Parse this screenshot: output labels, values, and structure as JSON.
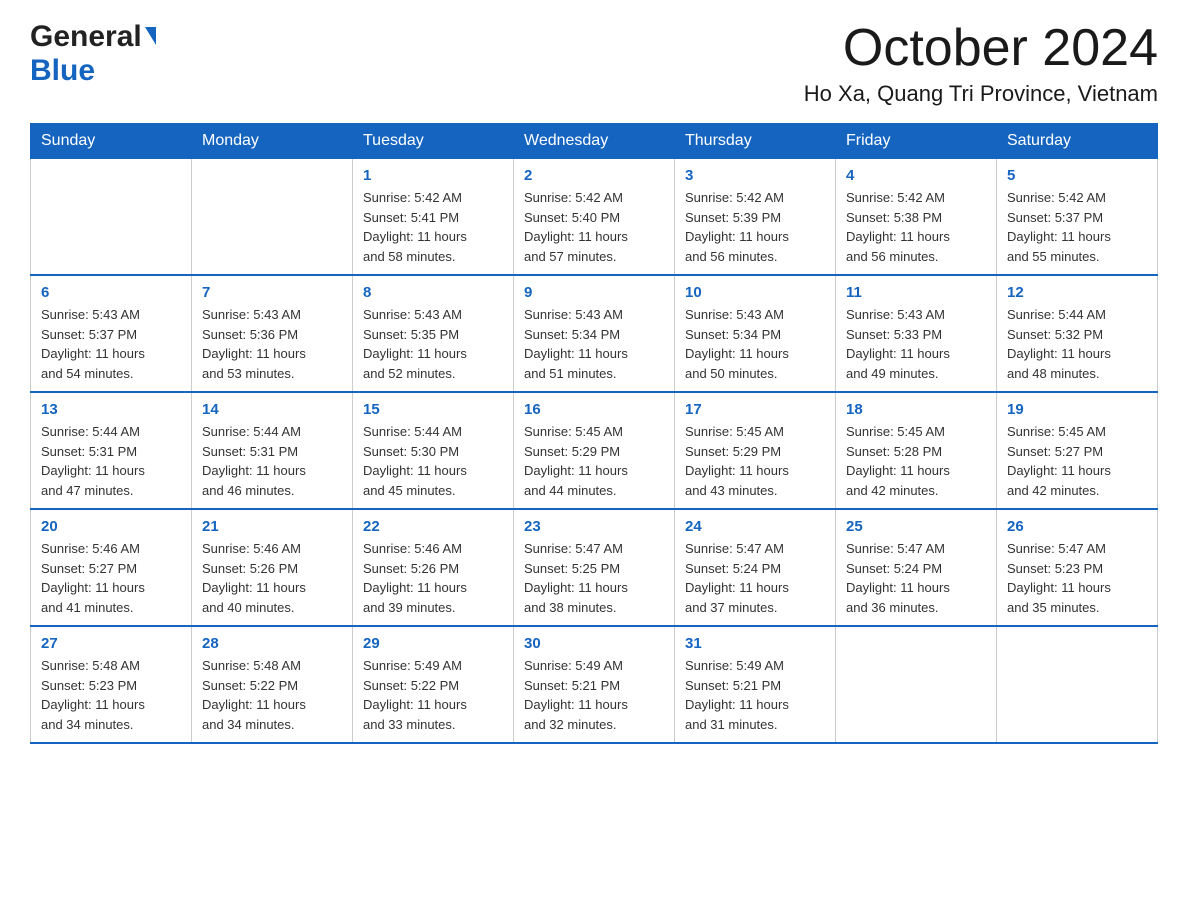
{
  "header": {
    "logo_general": "General",
    "logo_blue": "Blue",
    "month_title": "October 2024",
    "location": "Ho Xa, Quang Tri Province, Vietnam"
  },
  "calendar": {
    "days_of_week": [
      "Sunday",
      "Monday",
      "Tuesday",
      "Wednesday",
      "Thursday",
      "Friday",
      "Saturday"
    ],
    "weeks": [
      [
        {
          "day": "",
          "info": ""
        },
        {
          "day": "",
          "info": ""
        },
        {
          "day": "1",
          "info": "Sunrise: 5:42 AM\nSunset: 5:41 PM\nDaylight: 11 hours\nand 58 minutes."
        },
        {
          "day": "2",
          "info": "Sunrise: 5:42 AM\nSunset: 5:40 PM\nDaylight: 11 hours\nand 57 minutes."
        },
        {
          "day": "3",
          "info": "Sunrise: 5:42 AM\nSunset: 5:39 PM\nDaylight: 11 hours\nand 56 minutes."
        },
        {
          "day": "4",
          "info": "Sunrise: 5:42 AM\nSunset: 5:38 PM\nDaylight: 11 hours\nand 56 minutes."
        },
        {
          "day": "5",
          "info": "Sunrise: 5:42 AM\nSunset: 5:37 PM\nDaylight: 11 hours\nand 55 minutes."
        }
      ],
      [
        {
          "day": "6",
          "info": "Sunrise: 5:43 AM\nSunset: 5:37 PM\nDaylight: 11 hours\nand 54 minutes."
        },
        {
          "day": "7",
          "info": "Sunrise: 5:43 AM\nSunset: 5:36 PM\nDaylight: 11 hours\nand 53 minutes."
        },
        {
          "day": "8",
          "info": "Sunrise: 5:43 AM\nSunset: 5:35 PM\nDaylight: 11 hours\nand 52 minutes."
        },
        {
          "day": "9",
          "info": "Sunrise: 5:43 AM\nSunset: 5:34 PM\nDaylight: 11 hours\nand 51 minutes."
        },
        {
          "day": "10",
          "info": "Sunrise: 5:43 AM\nSunset: 5:34 PM\nDaylight: 11 hours\nand 50 minutes."
        },
        {
          "day": "11",
          "info": "Sunrise: 5:43 AM\nSunset: 5:33 PM\nDaylight: 11 hours\nand 49 minutes."
        },
        {
          "day": "12",
          "info": "Sunrise: 5:44 AM\nSunset: 5:32 PM\nDaylight: 11 hours\nand 48 minutes."
        }
      ],
      [
        {
          "day": "13",
          "info": "Sunrise: 5:44 AM\nSunset: 5:31 PM\nDaylight: 11 hours\nand 47 minutes."
        },
        {
          "day": "14",
          "info": "Sunrise: 5:44 AM\nSunset: 5:31 PM\nDaylight: 11 hours\nand 46 minutes."
        },
        {
          "day": "15",
          "info": "Sunrise: 5:44 AM\nSunset: 5:30 PM\nDaylight: 11 hours\nand 45 minutes."
        },
        {
          "day": "16",
          "info": "Sunrise: 5:45 AM\nSunset: 5:29 PM\nDaylight: 11 hours\nand 44 minutes."
        },
        {
          "day": "17",
          "info": "Sunrise: 5:45 AM\nSunset: 5:29 PM\nDaylight: 11 hours\nand 43 minutes."
        },
        {
          "day": "18",
          "info": "Sunrise: 5:45 AM\nSunset: 5:28 PM\nDaylight: 11 hours\nand 42 minutes."
        },
        {
          "day": "19",
          "info": "Sunrise: 5:45 AM\nSunset: 5:27 PM\nDaylight: 11 hours\nand 42 minutes."
        }
      ],
      [
        {
          "day": "20",
          "info": "Sunrise: 5:46 AM\nSunset: 5:27 PM\nDaylight: 11 hours\nand 41 minutes."
        },
        {
          "day": "21",
          "info": "Sunrise: 5:46 AM\nSunset: 5:26 PM\nDaylight: 11 hours\nand 40 minutes."
        },
        {
          "day": "22",
          "info": "Sunrise: 5:46 AM\nSunset: 5:26 PM\nDaylight: 11 hours\nand 39 minutes."
        },
        {
          "day": "23",
          "info": "Sunrise: 5:47 AM\nSunset: 5:25 PM\nDaylight: 11 hours\nand 38 minutes."
        },
        {
          "day": "24",
          "info": "Sunrise: 5:47 AM\nSunset: 5:24 PM\nDaylight: 11 hours\nand 37 minutes."
        },
        {
          "day": "25",
          "info": "Sunrise: 5:47 AM\nSunset: 5:24 PM\nDaylight: 11 hours\nand 36 minutes."
        },
        {
          "day": "26",
          "info": "Sunrise: 5:47 AM\nSunset: 5:23 PM\nDaylight: 11 hours\nand 35 minutes."
        }
      ],
      [
        {
          "day": "27",
          "info": "Sunrise: 5:48 AM\nSunset: 5:23 PM\nDaylight: 11 hours\nand 34 minutes."
        },
        {
          "day": "28",
          "info": "Sunrise: 5:48 AM\nSunset: 5:22 PM\nDaylight: 11 hours\nand 34 minutes."
        },
        {
          "day": "29",
          "info": "Sunrise: 5:49 AM\nSunset: 5:22 PM\nDaylight: 11 hours\nand 33 minutes."
        },
        {
          "day": "30",
          "info": "Sunrise: 5:49 AM\nSunset: 5:21 PM\nDaylight: 11 hours\nand 32 minutes."
        },
        {
          "day": "31",
          "info": "Sunrise: 5:49 AM\nSunset: 5:21 PM\nDaylight: 11 hours\nand 31 minutes."
        },
        {
          "day": "",
          "info": ""
        },
        {
          "day": "",
          "info": ""
        }
      ]
    ]
  }
}
